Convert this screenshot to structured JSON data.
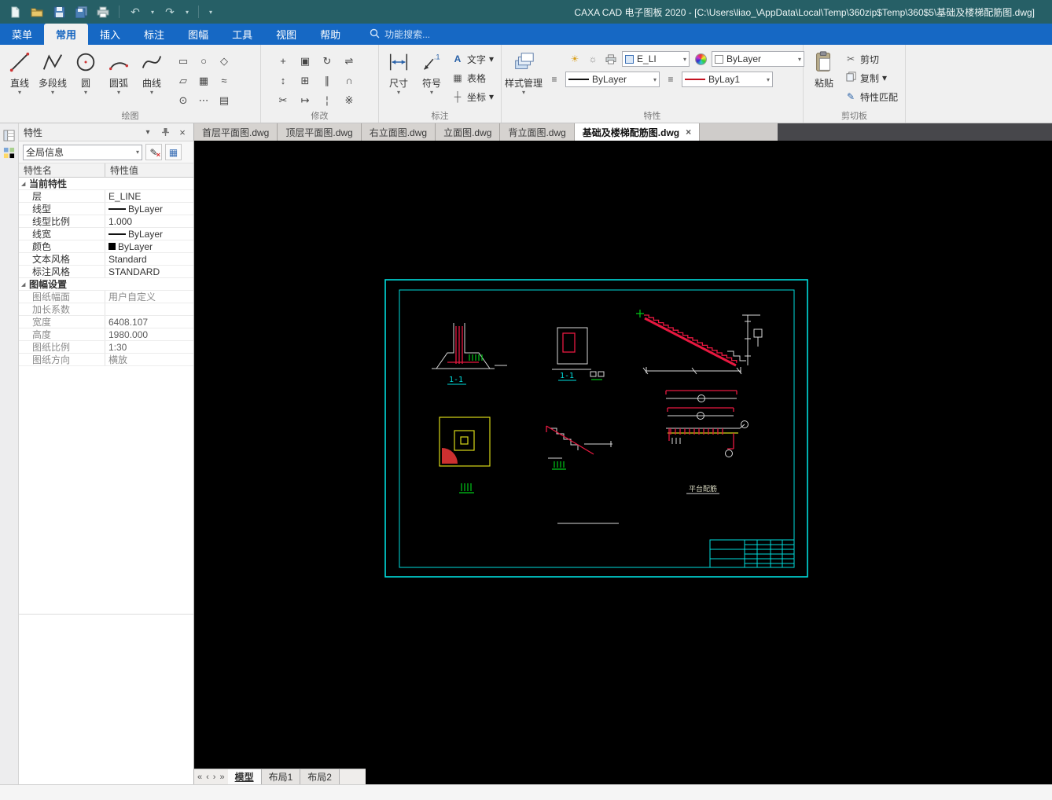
{
  "titlebar": {
    "title": "CAXA CAD 电子图板 2020 - [C:\\Users\\liao_\\AppData\\Local\\Temp\\360zip$Temp\\360$5\\基础及楼梯配筋图.dwg]"
  },
  "menubar": {
    "items": [
      {
        "label": "菜单",
        "active": false
      },
      {
        "label": "常用",
        "active": true
      },
      {
        "label": "插入",
        "active": false
      },
      {
        "label": "标注",
        "active": false
      },
      {
        "label": "图幅",
        "active": false
      },
      {
        "label": "工具",
        "active": false
      },
      {
        "label": "视图",
        "active": false
      },
      {
        "label": "帮助",
        "active": false
      }
    ],
    "search_hint": "功能搜索..."
  },
  "ribbon": {
    "draw": {
      "label": "绘图",
      "tools": [
        {
          "label": "直线"
        },
        {
          "label": "多段线"
        },
        {
          "label": "圆"
        },
        {
          "label": "圆弧"
        },
        {
          "label": "曲线"
        }
      ]
    },
    "modify": {
      "label": "修改"
    },
    "annotate": {
      "label": "标注",
      "dim": "尺寸",
      "symbol": "符号",
      "text": "文字",
      "table": "表格",
      "coord": "坐标"
    },
    "props": {
      "label": "特性",
      "style_manager": "样式管理",
      "layer_combo": "E_LI",
      "color_combo": "ByLayer",
      "linetype_combo": "ByLayer",
      "lineweight_combo": "ByLay1"
    },
    "clipboard": {
      "label": "剪切板",
      "paste": "粘贴",
      "cut": "剪切",
      "copy": "复制",
      "match": "特性匹配"
    }
  },
  "doc_tabs": [
    {
      "label": "首层平面图.dwg",
      "active": false
    },
    {
      "label": "顶层平面图.dwg",
      "active": false
    },
    {
      "label": "右立面图.dwg",
      "active": false
    },
    {
      "label": "立面图.dwg",
      "active": false
    },
    {
      "label": "背立面图.dwg",
      "active": false
    },
    {
      "label": "基础及楼梯配筋图.dwg",
      "active": true
    }
  ],
  "prop_panel": {
    "title": "特性",
    "scope_combo": "全局信息",
    "header": {
      "name": "特性名",
      "value": "特性值"
    },
    "group1": {
      "label": "当前特性",
      "rows": [
        {
          "name": "层",
          "value": "E_LINE"
        },
        {
          "name": "线型",
          "value": "ByLayer"
        },
        {
          "name": "线型比例",
          "value": "1.000"
        },
        {
          "name": "线宽",
          "value": "ByLayer"
        },
        {
          "name": "颜色",
          "value": "ByLayer"
        },
        {
          "name": "文本风格",
          "value": "Standard"
        },
        {
          "name": "标注风格",
          "value": "STANDARD"
        }
      ]
    },
    "group2": {
      "label": "图幅设置",
      "rows": [
        {
          "name": "图纸幅面",
          "value": "用户自定义"
        },
        {
          "name": "加长系数",
          "value": ""
        },
        {
          "name": "宽度",
          "value": "6408.107"
        },
        {
          "name": "高度",
          "value": "1980.000"
        },
        {
          "name": "图纸比例",
          "value": "1:30"
        },
        {
          "name": "图纸方向",
          "value": "横放"
        }
      ]
    }
  },
  "layout_tabs": [
    {
      "label": "模型",
      "active": true
    },
    {
      "label": "布局1",
      "active": false
    },
    {
      "label": "布局2",
      "active": false
    }
  ],
  "canvas": {
    "label_section1": "1-1",
    "label_section2": "1-1",
    "label_beam": "平台配筋"
  },
  "icons": {
    "dropdown": "▾",
    "close": "×",
    "undo": "↶",
    "redo": "↷",
    "cut": "✂",
    "match": "✎",
    "text_tool": "A",
    "table_tool": "▦",
    "coord_tool": "┼",
    "menu_lines": "≡",
    "layer_light": "☀",
    "layer_freeze": "☼",
    "group_marker": "◢",
    "nav_first": "«",
    "nav_prev": "‹",
    "nav_next": "›",
    "nav_last": "»",
    "draw_grid": [
      "▭",
      "○",
      "◇",
      "▱",
      "▦",
      "≈",
      "⊙",
      "⋯",
      "▤"
    ],
    "modify_grid": [
      "+",
      "▣",
      "↻",
      "⇌",
      "↕",
      "⊞",
      "∥",
      "∩",
      "✂",
      "↦",
      "¦",
      "※"
    ]
  },
  "colors": {
    "frame_cyan": "#00dcdc",
    "rebar_red": "#e81840",
    "hatch_green": "#00c818",
    "detail_yellow": "#d8d818",
    "menu_blue": "#1668c4",
    "title_teal": "#265f66"
  }
}
